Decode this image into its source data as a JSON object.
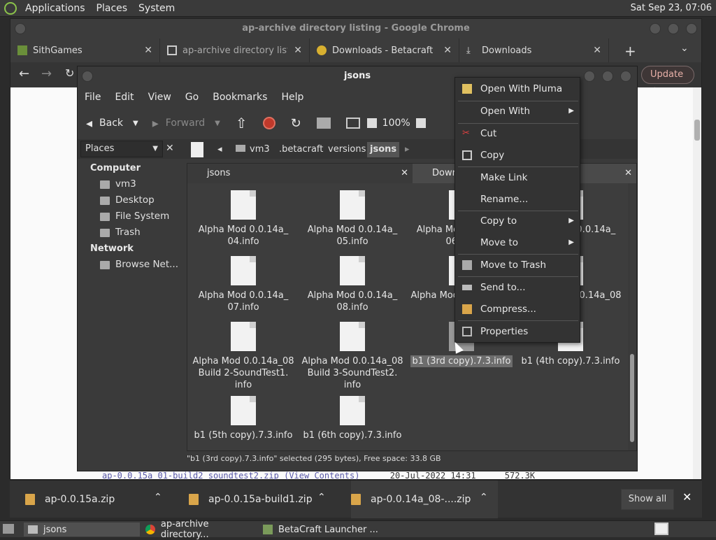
{
  "top_panel": {
    "menus": [
      "Applications",
      "Places",
      "System"
    ],
    "clock": "Sat Sep 23, 07:06"
  },
  "chrome": {
    "title": "ap-archive directory listing - Google Chrome",
    "tabs": [
      {
        "label": "SithGames"
      },
      {
        "label": "ap-archive directory listin"
      },
      {
        "label": "Downloads - Betacraft"
      },
      {
        "label": "Downloads"
      }
    ],
    "new_tab": "+",
    "update_label": "Update",
    "page_line": {
      "link": "ap-0.0.15a_01-build2_soundtest2.zip",
      "view": "(View Contents)",
      "date": "20-Jul-2022 14:31",
      "size": "572.3K"
    }
  },
  "downloads": {
    "items": [
      {
        "name": "ap-0.0.15a.zip"
      },
      {
        "name": "ap-0.0.15a-build1.zip"
      },
      {
        "name": "ap-0.0.14a_08-....zip"
      }
    ],
    "show_all": "Show all"
  },
  "taskbar": {
    "items": [
      "jsons",
      "ap-archive directory...",
      "BetaCraft Launcher ..."
    ]
  },
  "caja": {
    "title": "jsons",
    "menu": [
      "File",
      "Edit",
      "View",
      "Go",
      "Bookmarks",
      "Help"
    ],
    "toolbar": {
      "back": "Back",
      "forward": "Forward",
      "zoom": "100%"
    },
    "places_label": "Places",
    "breadcrumbs": [
      "vm3",
      ".betacraft",
      "versions",
      "jsons"
    ],
    "sidebar": {
      "computer_header": "Computer",
      "computer_items": [
        "vm3",
        "Desktop",
        "File System",
        "Trash"
      ],
      "network_header": "Network",
      "network_items": [
        "Browse Net..."
      ]
    },
    "content_tabs": [
      "jsons",
      "Down"
    ],
    "files": [
      {
        "name": "Alpha Mod 0.0.14a_ 04.info"
      },
      {
        "name": "Alpha Mod 0.0.14a_ 05.info"
      },
      {
        "name": "Alpha Mod 0.0.14a_ 06.info"
      },
      {
        "name": "Alpha Mod 0.0.14a_ info"
      },
      {
        "name": "Alpha Mod 0.0.14a_ 07.info"
      },
      {
        "name": "Alpha Mod 0.0.14a_ 08.info"
      },
      {
        "name": "Alpha Mod 0.0.14a_08 ..."
      },
      {
        "name": "Alpha Mod 0.0.14a_08"
      },
      {
        "name": "Alpha Mod 0.0.14a_08 Build 2-SoundTest1. info"
      },
      {
        "name": "Alpha Mod 0.0.14a_08 Build 3-SoundTest2. info"
      },
      {
        "name": "b1 (3rd copy).7.3.info",
        "selected": true
      },
      {
        "name": "b1 (4th copy).7.3.info"
      },
      {
        "name": "b1 (5th copy).7.3.info"
      },
      {
        "name": "b1 (6th copy).7.3.info"
      }
    ],
    "status": "\"b1 (3rd copy).7.3.info\" selected (295 bytes), Free space: 33.8 GB"
  },
  "context_menu": {
    "items": [
      {
        "label": "Open With Pluma",
        "icon": "pluma-icon"
      },
      {
        "label": "Open With",
        "submenu": true
      },
      {
        "label": "Cut",
        "icon": "scissors-icon"
      },
      {
        "label": "Copy",
        "icon": "copy-icon"
      },
      {
        "label": "Make Link"
      },
      {
        "label": "Rename..."
      },
      {
        "label": "Copy to",
        "submenu": true
      },
      {
        "label": "Move to",
        "submenu": true
      },
      {
        "label": "Move to Trash",
        "icon": "trash-icon"
      },
      {
        "label": "Send to...",
        "icon": "send-icon"
      },
      {
        "label": "Compress...",
        "icon": "archive-icon"
      },
      {
        "label": "Properties",
        "icon": "properties-icon"
      }
    ]
  }
}
